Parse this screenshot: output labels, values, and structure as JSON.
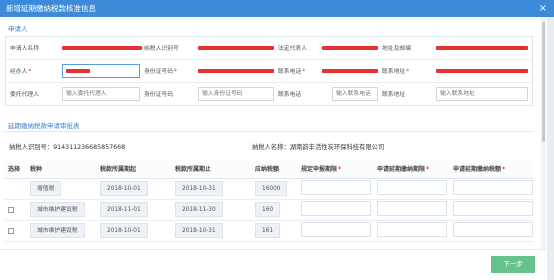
{
  "dialog": {
    "title": "新增延期缴纳税款核准信息",
    "close_glyph": "×"
  },
  "section_applicant": {
    "title": "申请人"
  },
  "applicant": {
    "row1": {
      "name_label": "申请人名称",
      "taxpayer_id_label": "纳税人识别号",
      "legal_rep_label": "法定代表人",
      "address_label": "地址及邮编"
    },
    "row2": {
      "handler_label": "经办人",
      "id_no_label": "身份证号码",
      "phone_label": "联系电话",
      "contact_addr_label": "联系地址"
    },
    "row3": {
      "agent_label": "委托代理人",
      "agent_placeholder": "输入委托代理人",
      "id_no_label": "身份证号码",
      "id_no_placeholder": "输入身份证号码",
      "phone_label": "联系电话",
      "phone_placeholder": "输入联系电话",
      "addr_label": "联系地址",
      "addr_placeholder": "输入联系地址"
    },
    "required_mark": "*"
  },
  "section_table": {
    "title": "延期缴纳税款申请审批表"
  },
  "info": {
    "taxpayer_id_text": "纳税人识别号：914311236685857668",
    "taxpayer_name_text": "纳税人名称：湖南韵丰活性炭环保科技有限公司"
  },
  "table": {
    "headers": [
      "选择",
      "税种",
      "税款所属期起",
      "税款所属期止",
      "应纳税额",
      "规定申报期限",
      "申请延期缴纳期限",
      "申请延期缴纳税额"
    ],
    "rows": [
      {
        "tax": "增值税",
        "start": "2018-10-01",
        "end": "2018-10-31",
        "amount": "16000"
      },
      {
        "tax": "城市维护建设税",
        "start": "2018-11-01",
        "end": "2018-11-30",
        "amount": "160"
      },
      {
        "tax": "城市维护建设税",
        "start": "2018-10-01",
        "end": "2018-10-31",
        "amount": "161"
      }
    ]
  },
  "footer": {
    "next_label": "下一步"
  },
  "colors": {
    "title_bar": "#3d8ad8",
    "accent": "#3d7fc4",
    "next_button": "#66c28a",
    "redaction": "#e23232"
  }
}
